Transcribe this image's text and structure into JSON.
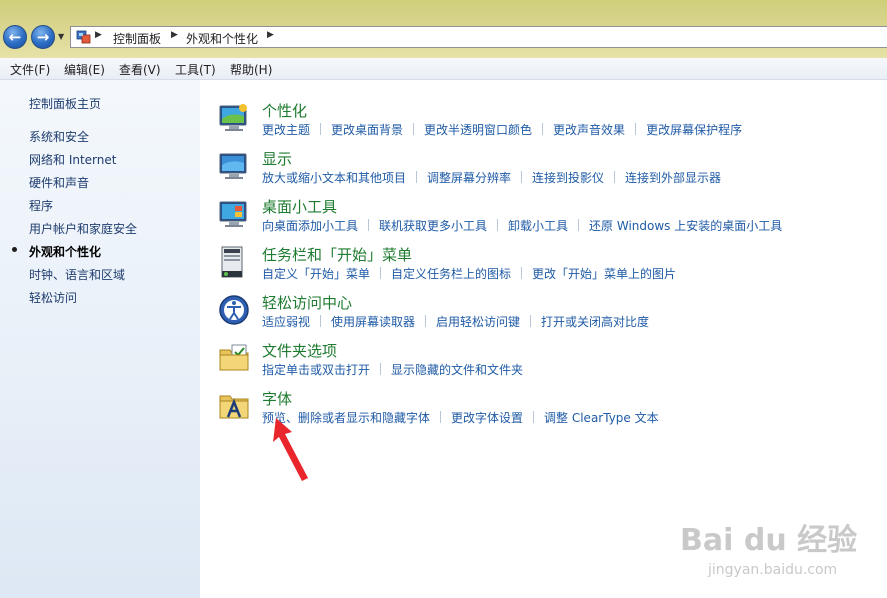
{
  "address": {
    "crumbs": [
      "控制面板",
      "外观和个性化"
    ]
  },
  "menu": {
    "items": [
      "文件(F)",
      "编辑(E)",
      "查看(V)",
      "工具(T)",
      "帮助(H)"
    ]
  },
  "sidebar": {
    "home": "控制面板主页",
    "items": [
      "系统和安全",
      "网络和 Internet",
      "硬件和声音",
      "程序",
      "用户帐户和家庭安全",
      "外观和个性化",
      "时钟、语言和区域",
      "轻松访问"
    ],
    "active_index": 5
  },
  "categories": [
    {
      "title": "个性化",
      "icon": "personalization-icon",
      "links": [
        "更改主题",
        "更改桌面背景",
        "更改半透明窗口颜色",
        "更改声音效果",
        "更改屏幕保护程序"
      ]
    },
    {
      "title": "显示",
      "icon": "display-icon",
      "links": [
        "放大或缩小文本和其他项目",
        "调整屏幕分辨率",
        "连接到投影仪",
        "连接到外部显示器"
      ]
    },
    {
      "title": "桌面小工具",
      "icon": "gadgets-icon",
      "links": [
        "向桌面添加小工具",
        "联机获取更多小工具",
        "卸载小工具",
        "还原 Windows 上安装的桌面小工具"
      ]
    },
    {
      "title": "任务栏和「开始」菜单",
      "icon": "taskbar-icon",
      "links": [
        "自定义「开始」菜单",
        "自定义任务栏上的图标",
        "更改「开始」菜单上的图片"
      ]
    },
    {
      "title": "轻松访问中心",
      "icon": "ease-of-access-icon",
      "links": [
        "适应弱视",
        "使用屏幕读取器",
        "启用轻松访问键",
        "打开或关闭高对比度"
      ]
    },
    {
      "title": "文件夹选项",
      "icon": "folder-options-icon",
      "links": [
        "指定单击或双击打开",
        "显示隐藏的文件和文件夹"
      ]
    },
    {
      "title": "字体",
      "icon": "fonts-icon",
      "links": [
        "预览、删除或者显示和隐藏字体",
        "更改字体设置",
        "调整 ClearType 文本"
      ]
    }
  ],
  "watermark": {
    "brand": "Bai du 经验",
    "url": "jingyan.baidu.com"
  },
  "colors": {
    "category_title": "#1e7b2f",
    "link": "#1f5ba6",
    "annotation_arrow": "#e8262c"
  }
}
